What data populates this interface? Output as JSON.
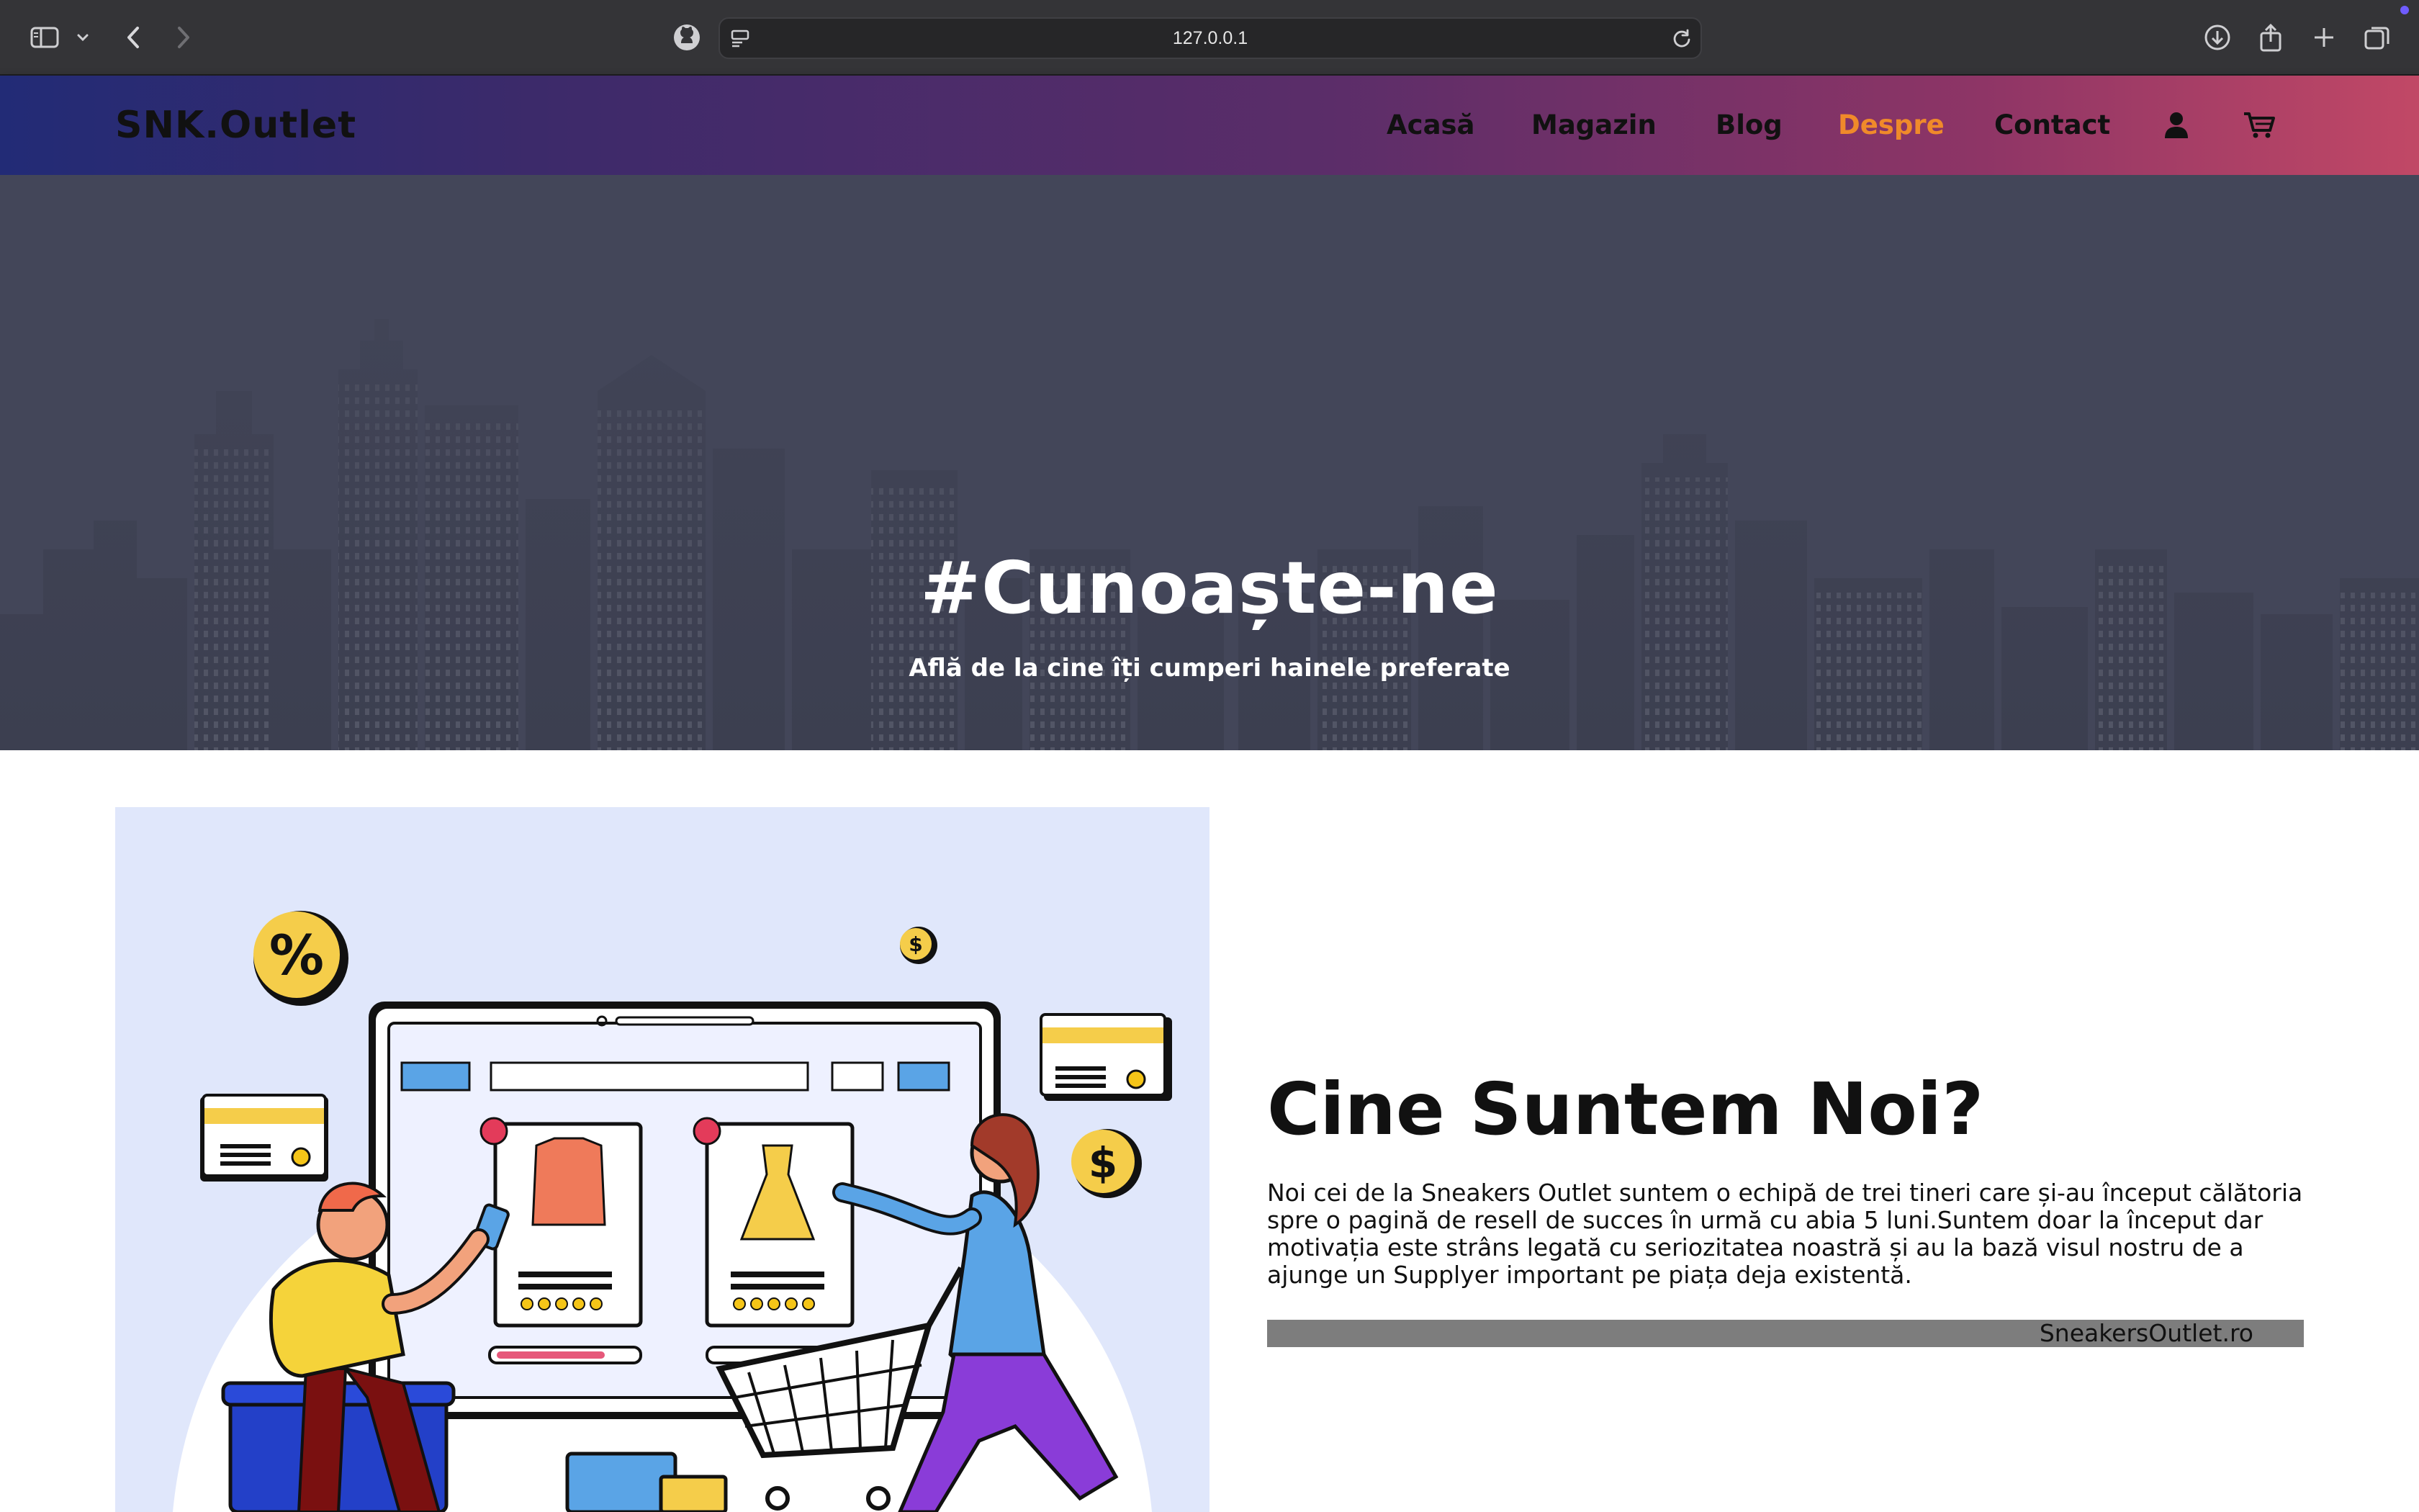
{
  "browser": {
    "url": "127.0.0.1",
    "icons": [
      "sidebar-icon",
      "chevron-down-icon",
      "back-icon",
      "forward-icon",
      "github-icon",
      "page-settings-icon",
      "reload-icon",
      "download-icon",
      "share-icon",
      "new-tab-icon",
      "tab-overview-icon"
    ]
  },
  "header": {
    "logo": "SNK.Outlet",
    "nav": [
      {
        "label": "Acasă",
        "active": false
      },
      {
        "label": "Magazin",
        "active": false
      },
      {
        "label": "Blog",
        "active": false
      },
      {
        "label": "Despre",
        "active": true
      },
      {
        "label": "Contact",
        "active": false
      }
    ],
    "icons": [
      "user-icon",
      "cart-icon"
    ],
    "active_color": "#f08a2a"
  },
  "hero": {
    "title": "#Cunoaște-ne",
    "subtitle": "Află de la cine îți cumperi hainele preferate"
  },
  "about": {
    "title": "Cine Suntem Noi?",
    "text": "Noi cei de la Sneakers Outlet suntem o echipă de trei tineri care și-au început călătoria spre o pagină de resell de succes în urmă cu abia 5 luni.Suntem doar la început dar motivația este strâns legată cu seriozitatea noastră și au la bază visul nostru de a ajunge un Supplyer important pe piața deja existentă.",
    "signature": "SneakersOutlet.ro"
  }
}
